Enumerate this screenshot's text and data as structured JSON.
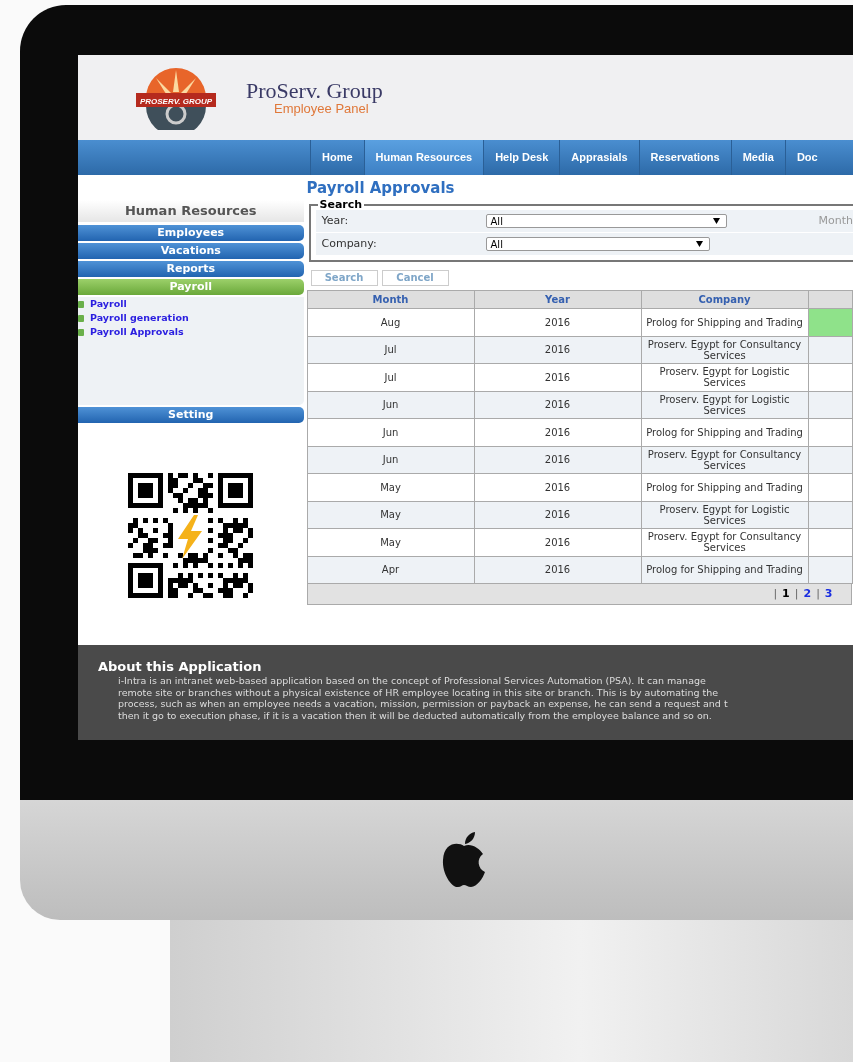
{
  "header": {
    "logo_text": "PROSERV. GROUP",
    "title": "ProServ. Group",
    "subtitle": "Employee Panel"
  },
  "nav": [
    {
      "label": "Home",
      "selected": false
    },
    {
      "label": "Human Resources",
      "selected": true
    },
    {
      "label": "Help Desk",
      "selected": false
    },
    {
      "label": "Apprasials",
      "selected": false
    },
    {
      "label": "Reservations",
      "selected": false
    },
    {
      "label": "Media",
      "selected": false
    },
    {
      "label": "Doc",
      "selected": false
    }
  ],
  "sidebar": {
    "title": "Human Resources",
    "menu": [
      {
        "label": "Employees",
        "selected": false
      },
      {
        "label": "Vacations",
        "selected": false
      },
      {
        "label": "Reports",
        "selected": false
      },
      {
        "label": "Payroll",
        "selected": true,
        "children": [
          {
            "label": "Payroll"
          },
          {
            "label": "Payroll generation"
          },
          {
            "label": "Payroll Approvals"
          }
        ]
      },
      {
        "label": "Setting",
        "selected": false
      }
    ]
  },
  "page_title": "Payroll Approvals",
  "search": {
    "legend": "Search",
    "fields": [
      {
        "label": "Year:",
        "value": "All"
      },
      {
        "label": "Company:",
        "value": "All"
      }
    ],
    "side_label": "Month",
    "buttons": [
      "Search",
      "Cancel"
    ]
  },
  "table": {
    "columns": [
      "Month",
      "Year",
      "Company"
    ],
    "rows": [
      {
        "cells": [
          "Aug",
          "2016",
          "Prolog for Shipping and Trading"
        ],
        "highlighted": true
      },
      {
        "cells": [
          "Jul",
          "2016",
          "Proserv. Egypt for Consultancy Services"
        ],
        "highlighted": false
      },
      {
        "cells": [
          "Jul",
          "2016",
          "Proserv. Egypt for Logistic Services"
        ],
        "highlighted": false
      },
      {
        "cells": [
          "Jun",
          "2016",
          "Proserv. Egypt for Logistic Services"
        ],
        "highlighted": false
      },
      {
        "cells": [
          "Jun",
          "2016",
          "Prolog for Shipping and Trading"
        ],
        "highlighted": false
      },
      {
        "cells": [
          "Jun",
          "2016",
          "Proserv. Egypt for Consultancy Services"
        ],
        "highlighted": false
      },
      {
        "cells": [
          "May",
          "2016",
          "Prolog for Shipping and Trading"
        ],
        "highlighted": false
      },
      {
        "cells": [
          "May",
          "2016",
          "Proserv. Egypt for Logistic Services"
        ],
        "highlighted": false
      },
      {
        "cells": [
          "May",
          "2016",
          "Proserv. Egypt for Consultancy Services"
        ],
        "highlighted": false
      },
      {
        "cells": [
          "Apr",
          "2016",
          "Prolog for Shipping and Trading"
        ],
        "highlighted": false
      }
    ],
    "pager": [
      {
        "separator": "|",
        "label": "1",
        "selected": true
      },
      {
        "separator": "|",
        "label": "2",
        "selected": false
      },
      {
        "separator": "|",
        "label": "3",
        "selected": false
      }
    ]
  },
  "footer": {
    "title": "About this Application",
    "lines": [
      "i-Intra is an intranet web-based application based on the concept of Professional Services Automation (PSA). It can manage",
      "remote site or branches without a physical existence of HR employee locating in this site or branch. This is by automating the",
      "process, such as when an employee needs a vacation, mission, permission or payback an expense, he can send a request and t",
      "then it go to execution phase, if it is a vacation then it will be deducted automatically from the employee balance and so on."
    ]
  }
}
